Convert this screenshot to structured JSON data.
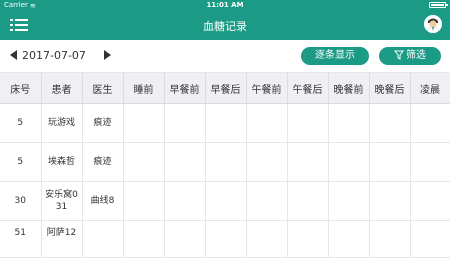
{
  "status_bar": {
    "carrier": "Carrier",
    "time": "11:01 AM"
  },
  "nav": {
    "title": "血糖记录",
    "menu_icon": "list-menu-icon",
    "avatar_icon": "doctor-avatar-icon"
  },
  "toolbar": {
    "date": "2017-07-07",
    "detail_label": "逐条显示",
    "filter_label": "筛选"
  },
  "colors": {
    "primary": "#1b9b86",
    "header_bg": "#efeff4"
  },
  "table": {
    "columns": [
      "床号",
      "患者",
      "医生",
      "睡前",
      "早餐前",
      "早餐后",
      "午餐前",
      "午餐后",
      "晚餐前",
      "晚餐后",
      "凌晨"
    ],
    "rows": [
      {
        "bed": "5",
        "patient": "玩游戏",
        "doctor": "痕迹"
      },
      {
        "bed": "5",
        "patient": "埃森哲",
        "doctor": "痕迹"
      },
      {
        "bed": "30",
        "patient": "安乐窝031",
        "doctor": "曲线8"
      },
      {
        "bed": "51",
        "patient": "阿萨12",
        "doctor": ""
      }
    ]
  }
}
